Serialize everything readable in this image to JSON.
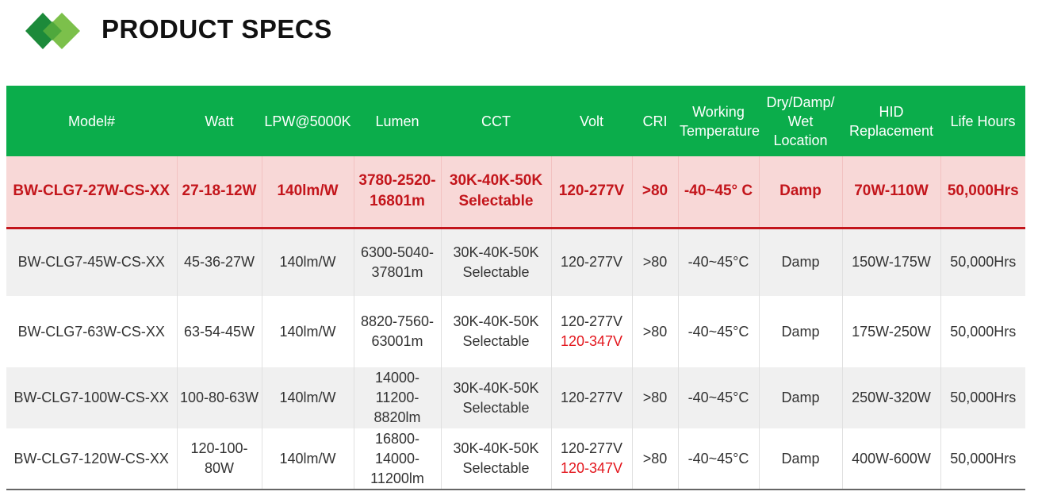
{
  "header": {
    "title": "PRODUCT SPECS",
    "colors": {
      "logo_dark": "#1c8a3a",
      "logo_light": "#7cc04b",
      "header_bg": "#0bad4b",
      "accent_red": "#c3151b"
    }
  },
  "table": {
    "columns": [
      {
        "line1": "Model#",
        "line2": ""
      },
      {
        "line1": "Watt",
        "line2": ""
      },
      {
        "line1": "LPW@5000K",
        "line2": ""
      },
      {
        "line1": "Lumen",
        "line2": ""
      },
      {
        "line1": "CCT",
        "line2": ""
      },
      {
        "line1": "Volt",
        "line2": ""
      },
      {
        "line1": "CRI",
        "line2": ""
      },
      {
        "line1": "Working",
        "line2": "Temperature"
      },
      {
        "line1": "Dry/Damp/",
        "line2": "Wet Location"
      },
      {
        "line1": "HID",
        "line2": "Replacement"
      },
      {
        "line1": "Life Hours",
        "line2": ""
      }
    ],
    "featured": {
      "model": "BW-CLG7-27W-CS-XX",
      "watt": "27-18-12W",
      "lpw": "140lm/W",
      "lumen1": "3780-2520-",
      "lumen2": "16801m",
      "cct1": "30K-40K-50K",
      "cct2": "Selectable",
      "volt": "120-277V",
      "cri": ">80",
      "temp": "-40~45° C",
      "location": "Damp",
      "hid": "70W-110W",
      "life": "50,000Hrs"
    },
    "rows": [
      {
        "model": "BW-CLG7-45W-CS-XX",
        "watt": "45-36-27W",
        "lpw": "140lm/W",
        "lumen1": "6300-5040-",
        "lumen2": "37801m",
        "cct1": "30K-40K-50K",
        "cct2": "Selectable",
        "volt1": "120-277V",
        "volt2": "",
        "cri": ">80",
        "temp": "-40~45°C",
        "location": "Damp",
        "hid": "150W-175W",
        "life": "50,000Hrs"
      },
      {
        "model": "BW-CLG7-63W-CS-XX",
        "watt": "63-54-45W",
        "lpw": "140lm/W",
        "lumen1": "8820-7560-",
        "lumen2": "63001m",
        "cct1": "30K-40K-50K",
        "cct2": "Selectable",
        "volt1": "120-277V",
        "volt2": "120-347V",
        "cri": ">80",
        "temp": "-40~45°C",
        "location": "Damp",
        "hid": "175W-250W",
        "life": "50,000Hrs"
      },
      {
        "model": "BW-CLG7-100W-CS-XX",
        "watt": "100-80-63W",
        "lpw": "140lm/W",
        "lumen1": "14000-11200-",
        "lumen2": "8820lm",
        "cct1": "30K-40K-50K",
        "cct2": "Selectable",
        "volt1": "120-277V",
        "volt2": "",
        "cri": ">80",
        "temp": "-40~45°C",
        "location": "Damp",
        "hid": "250W-320W",
        "life": "50,000Hrs"
      },
      {
        "model": "BW-CLG7-120W-CS-XX",
        "watt": "120-100-80W",
        "lpw": "140lm/W",
        "lumen1": "16800-14000-",
        "lumen2": "11200lm",
        "cct1": "30K-40K-50K",
        "cct2": "Selectable",
        "volt1": "120-277V",
        "volt2": "120-347V",
        "cri": ">80",
        "temp": "-40~45°C",
        "location": "Damp",
        "hid": "400W-600W",
        "life": "50,000Hrs"
      }
    ]
  }
}
